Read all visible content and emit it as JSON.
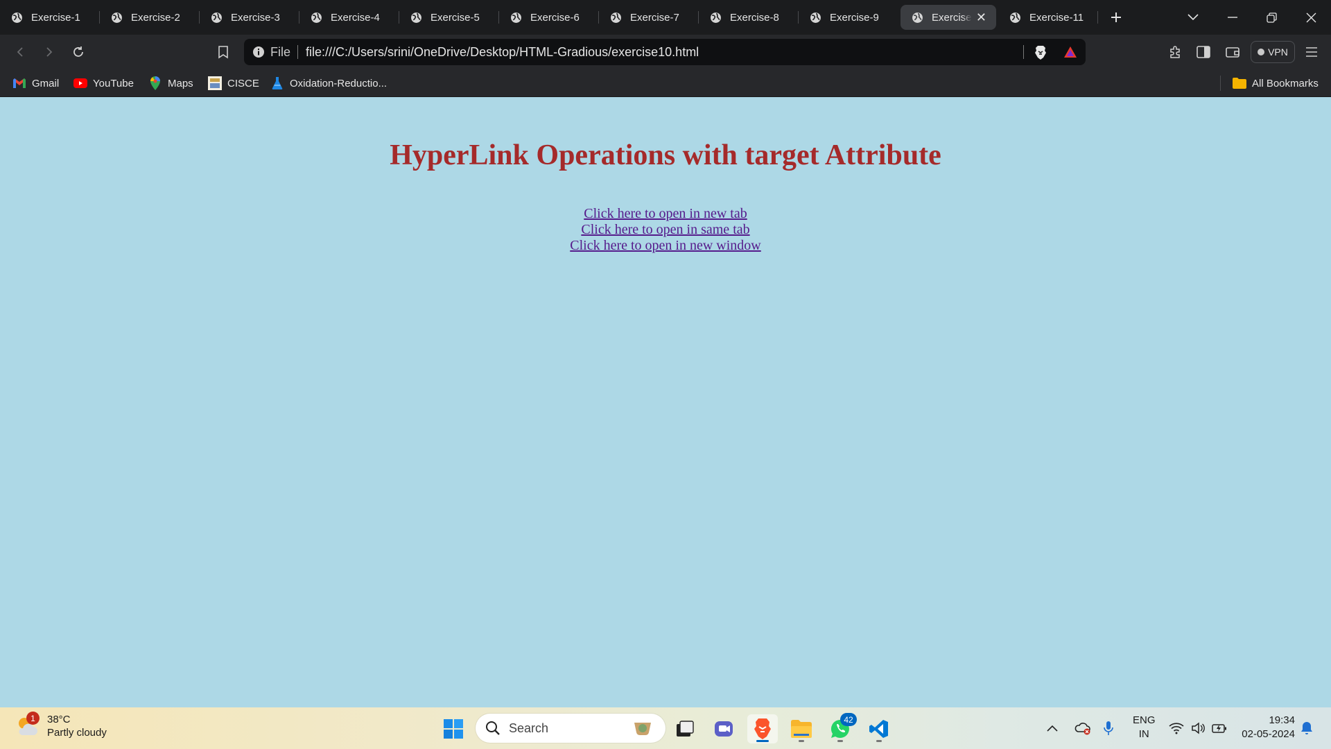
{
  "browser": {
    "tabs": [
      {
        "title": "Exercise-1"
      },
      {
        "title": "Exercise-2"
      },
      {
        "title": "Exercise-3"
      },
      {
        "title": "Exercise-4"
      },
      {
        "title": "Exercise-5"
      },
      {
        "title": "Exercise-6"
      },
      {
        "title": "Exercise-7"
      },
      {
        "title": "Exercise-8"
      },
      {
        "title": "Exercise-9"
      },
      {
        "title": "Exercise-10",
        "active": true
      },
      {
        "title": "Exercise-11"
      }
    ],
    "address": {
      "scheme_label": "File",
      "url": "file:///C:/Users/srini/OneDrive/Desktop/HTML-Gradious/exercise10.html"
    },
    "vpn_label": "VPN",
    "bookmarks": [
      {
        "label": "Gmail",
        "icon": "gmail-icon"
      },
      {
        "label": "YouTube",
        "icon": "youtube-icon"
      },
      {
        "label": "Maps",
        "icon": "maps-icon"
      },
      {
        "label": "CISCE",
        "icon": "cisce-icon"
      },
      {
        "label": "Oxidation-Reductio...",
        "icon": "flask-icon"
      }
    ],
    "all_bookmarks_label": "All Bookmarks"
  },
  "page": {
    "heading": "HyperLink Operations with target Attribute",
    "links": [
      "Click here to open in new tab",
      "Click here to open in same tab",
      "Click here to open in new window"
    ],
    "background_color": "#add8e6",
    "heading_color": "#a52a2a",
    "link_color": "#551a8b"
  },
  "taskbar": {
    "weather": {
      "temp": "38°C",
      "condition": "Partly cloudy",
      "badge": "1"
    },
    "search_placeholder": "Search",
    "whatsapp_badge": "42",
    "language": {
      "line1": "ENG",
      "line2": "IN"
    },
    "time": "19:34",
    "date": "02-05-2024"
  }
}
